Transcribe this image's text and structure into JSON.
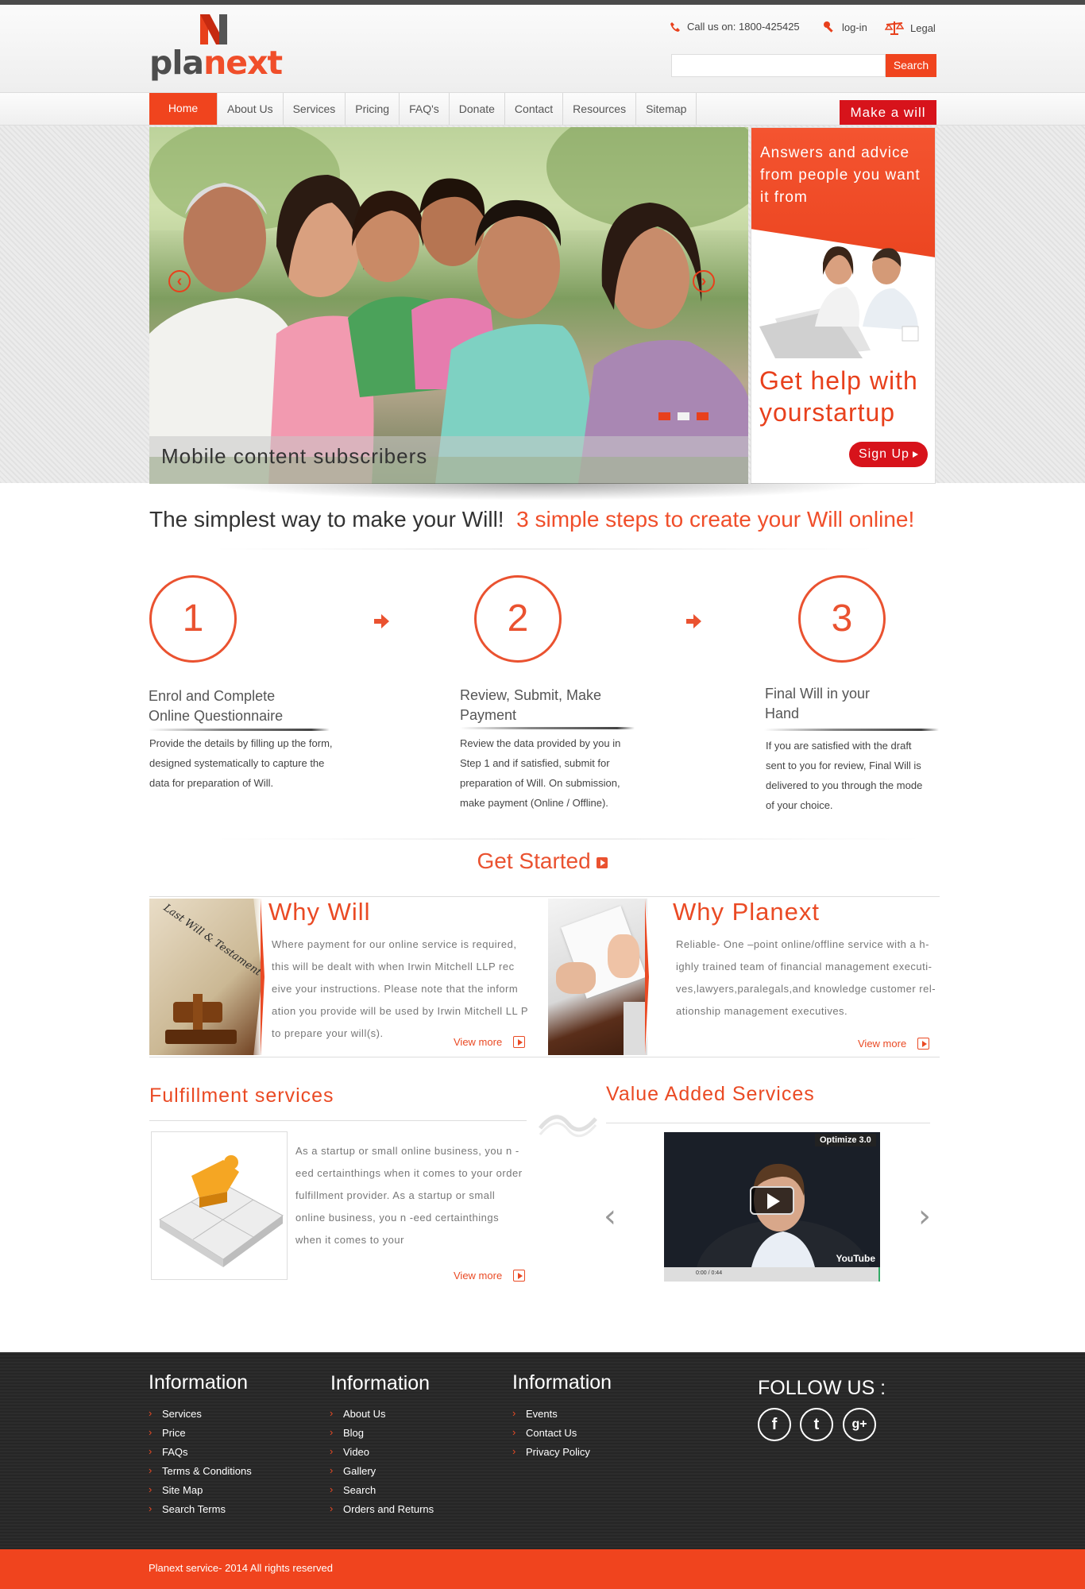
{
  "header": {
    "logo_text_a": "pla",
    "logo_text_b": "next",
    "phone": "Call us on: 1800-425425",
    "login": "log-in",
    "legal": "Legal",
    "search_button": "Search"
  },
  "nav": {
    "items": [
      "Home",
      "About Us",
      "Services",
      "Pricing",
      "FAQ's",
      "Donate",
      "Contact",
      "Resources",
      "Sitemap"
    ],
    "cta": "Make a will"
  },
  "hero": {
    "caption": "Mobile content subscribers",
    "slides_total": 3,
    "slide_active": 1
  },
  "promo": {
    "text": "Answers and advice from people you want it from",
    "headline": "Get help with yourstartup",
    "signup": "Sign Up"
  },
  "tagline": {
    "part1": "The simplest way to make your Will!",
    "part2": "3 simple steps to create your Will online!"
  },
  "steps": [
    {
      "number": "1",
      "title": "Enrol and Complete Online Questionnaire",
      "desc": "Provide the details by filling up the form, designed systematically to capture the data for preparation of Will."
    },
    {
      "number": "2",
      "title": "Review, Submit, Make Payment",
      "desc": "Review the data provided by you in Step 1 and if satisfied, submit for preparation of Will. On submission, make payment (Online / Offline)."
    },
    {
      "number": "3",
      "title": "Final Will in your Hand",
      "desc": "If you are satisfied with the draft sent to you for review, Final Will is delivered to you through the mode of your choice."
    }
  ],
  "get_started": "Get Started",
  "why_will": {
    "title": "Why Will",
    "image_text": "Last Will & Testament",
    "text": "Where payment for our online service is required, this will be dealt with when Irwin Mitchell LLP rec eive your instructions. Please note that the inform ation you provide will be used by Irwin Mitchell LL P to prepare your will(s).",
    "view_more": "View more"
  },
  "why_planext": {
    "title": "Why Planext",
    "text": "Reliable- One –point online/offline service with a h- ighly trained team of financial management executi- ves,lawyers,paralegals,and knowledge customer rel- ationship management executives.",
    "view_more": "View more"
  },
  "fulfillment": {
    "title": "Fulfillment services",
    "text": "As a startup or small online business, you n -eed certainthings when it comes to your order fulfillment provider. As a startup or small online business, you n -eed certainthings when it comes to your",
    "view_more": "View more"
  },
  "value_added": {
    "title": "Value Added Services",
    "video_label": "Optimize 3.0",
    "video_brand": "YouTube",
    "video_time": "0:00 / 0:44"
  },
  "footer": {
    "col1": {
      "title": "Information",
      "links": [
        "Services",
        "Price",
        "FAQs",
        "Terms & Conditions",
        "Site Map",
        "Search Terms"
      ]
    },
    "col2": {
      "title": "Information",
      "links": [
        "About Us",
        "Blog",
        "Video",
        "Gallery",
        "Search",
        "Orders and Returns"
      ]
    },
    "col3": {
      "title": "Information",
      "links": [
        "Events",
        "Contact Us",
        "Privacy Policy"
      ]
    },
    "follow": "FOLLOW US :",
    "social": [
      "f",
      "t",
      "g+"
    ],
    "copyright": "Planext service- 2014 All rights reserved"
  },
  "colors": {
    "accent": "#f0441e",
    "cta_red": "#d7131b",
    "footer_bg": "#2a2a2a"
  }
}
